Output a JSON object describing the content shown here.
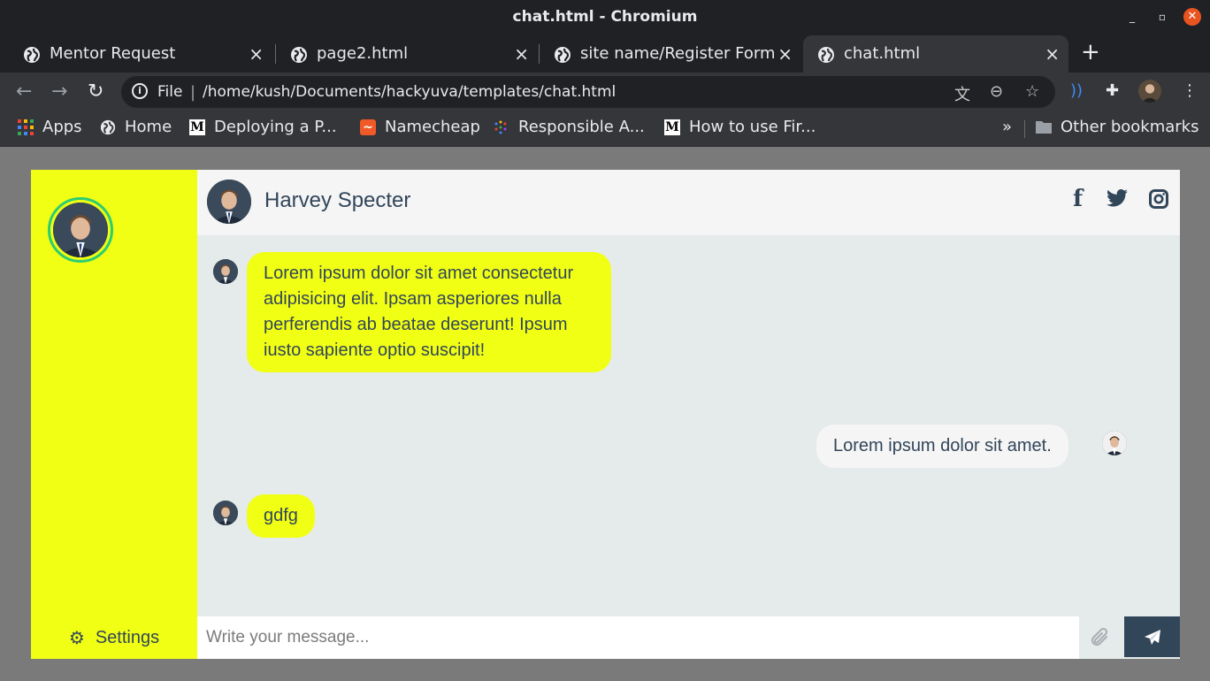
{
  "window": {
    "title": "chat.html - Chromium"
  },
  "tabs": [
    {
      "label": "Mentor Request",
      "close": "×"
    },
    {
      "label": "page2.html",
      "close": "×"
    },
    {
      "label": "site name/Register Form",
      "close": "×"
    },
    {
      "label": "chat.html",
      "close": "×",
      "active": true
    }
  ],
  "toolbar": {
    "back": "←",
    "forward": "→",
    "reload": "↻",
    "info": "i",
    "scheme_label": "File",
    "url": "/home/kush/Documents/hackyuva/templates/chat.html",
    "new_tab": "+"
  },
  "bookmarks": [
    {
      "label": "Apps",
      "icon": "apps-grid-icon"
    },
    {
      "label": "Home",
      "icon": "globe-icon"
    },
    {
      "label": "Deploying a P...",
      "icon": "medium-icon"
    },
    {
      "label": "Namecheap",
      "icon": "namecheap-icon"
    },
    {
      "label": "Responsible A...",
      "icon": "dots-icon"
    },
    {
      "label": "How to use Fir...",
      "icon": "medium-icon"
    }
  ],
  "bookmarks_overflow": "»",
  "other_bookmarks": "Other bookmarks",
  "chat": {
    "contact_name": "Harvey Specter",
    "settings_label": "Settings",
    "input_placeholder": "Write your message...",
    "messages": [
      {
        "type": "sent",
        "text": "Lorem ipsum dolor sit amet consectetur adipisicing elit. Ipsam asperiores nulla perferendis ab beatae deserunt! Ipsum iusto sapiente optio suscipit!"
      },
      {
        "type": "replied",
        "text": "Lorem ipsum dolor sit amet."
      },
      {
        "type": "sent",
        "text": "gdfg"
      }
    ]
  },
  "colors": {
    "sidebar": "#f0ff14",
    "sent_bubble": "#f0ff14",
    "replied_bubble": "#f5f5f5",
    "text": "#32465a",
    "chat_bg": "#e5eaea",
    "online_ring": "#2ecc71"
  }
}
